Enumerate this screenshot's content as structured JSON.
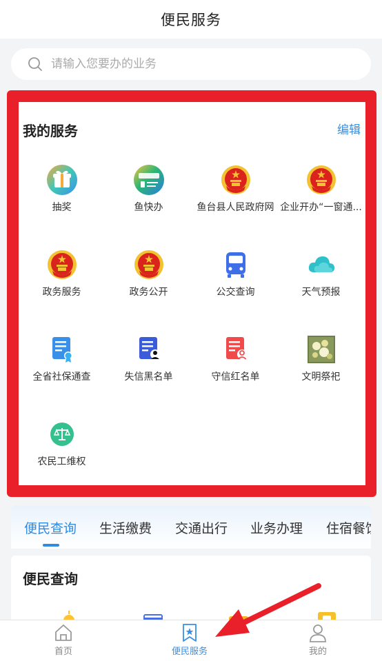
{
  "header": {
    "title": "便民服务"
  },
  "search": {
    "placeholder": "请输入您要办的业务"
  },
  "my_services": {
    "title": "我的服务",
    "edit_label": "编辑",
    "items": [
      {
        "label": "抽奖",
        "icon": "gift-icon"
      },
      {
        "label": "鱼快办",
        "icon": "yu-kuaiban-logo-icon"
      },
      {
        "label": "鱼台县人民政府网",
        "icon": "national-emblem-icon"
      },
      {
        "label": "企业开办“一窗通...",
        "icon": "national-emblem-icon"
      },
      {
        "label": "政务服务",
        "icon": "national-emblem-icon"
      },
      {
        "label": "政务公开",
        "icon": "national-emblem-icon"
      },
      {
        "label": "公交查询",
        "icon": "bus-icon"
      },
      {
        "label": "天气预报",
        "icon": "cloud-icon"
      },
      {
        "label": "全省社保通查",
        "icon": "certificate-doc-icon"
      },
      {
        "label": "失信黑名单",
        "icon": "blacklist-doc-icon"
      },
      {
        "label": "守信红名单",
        "icon": "redlist-doc-icon"
      },
      {
        "label": "文明祭祀",
        "icon": "flowers-photo-icon"
      },
      {
        "label": "农民工维权",
        "icon": "scales-icon"
      }
    ]
  },
  "category_tabs": [
    {
      "label": "便民查询",
      "active": true
    },
    {
      "label": "生活缴费"
    },
    {
      "label": "交通出行"
    },
    {
      "label": "业务办理"
    },
    {
      "label": "住宿餐饮"
    }
  ],
  "section": {
    "title": "便民查询"
  },
  "bottom_nav": [
    {
      "label": "首页",
      "icon": "home-icon"
    },
    {
      "label": "便民服务",
      "icon": "bookmark-star-icon",
      "active": true
    },
    {
      "label": "我的",
      "icon": "user-icon"
    }
  ],
  "colors": {
    "accent": "#3b8fe0",
    "highlight_frame": "#e9202a",
    "emblem_red": "#d9231c",
    "emblem_gold": "#f2c233"
  }
}
